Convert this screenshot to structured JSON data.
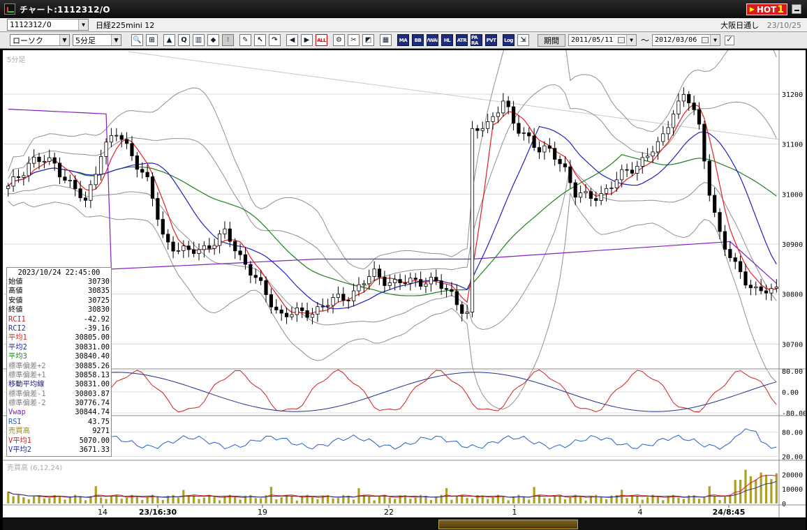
{
  "window": {
    "title": "チャート:1112312/O",
    "hot_badge": {
      "text": "HOT",
      "number": "1"
    }
  },
  "symbol_bar": {
    "symbol": "1112312/O",
    "name": "日経225mini 12",
    "session": "大阪日通し",
    "date": "23/10/25"
  },
  "toolbar": {
    "chart_type": "ローソク",
    "period": "5分足",
    "kikan_label": "期間",
    "date_from": "2011/05/11",
    "date_to": "2012/03/06",
    "date_separator": "〜",
    "buttons": [
      {
        "name": "zoom-icon",
        "glyph": "🔍"
      },
      {
        "name": "bar-width-icon",
        "glyph": "⊞"
      },
      {
        "name": "candle-add-icon",
        "glyph": "▲"
      },
      {
        "name": "search-chart-icon",
        "glyph": "Q"
      },
      {
        "name": "volume-icon",
        "glyph": "▥"
      },
      {
        "name": "split-icon",
        "glyph": "◆"
      },
      {
        "name": "warning-icon",
        "glyph": "!"
      },
      {
        "name": "pen-icon",
        "glyph": "✎"
      },
      {
        "name": "cursor-icon",
        "glyph": "↖"
      },
      {
        "name": "redo-icon",
        "glyph": "↷"
      },
      {
        "name": "candle-left-icon",
        "glyph": "◀"
      },
      {
        "name": "candle-right-icon",
        "glyph": "▶"
      },
      {
        "name": "all-icon",
        "glyph": "ALL"
      },
      {
        "name": "settings-icon",
        "glyph": "⚙"
      },
      {
        "name": "tools-icon",
        "glyph": "✂"
      },
      {
        "name": "color-icon",
        "glyph": "◩"
      },
      {
        "name": "grid-icon",
        "glyph": "▦"
      },
      {
        "name": "ma-icon",
        "glyph": "MA"
      },
      {
        "name": "bb-icon",
        "glyph": "BB"
      },
      {
        "name": "vwae-icon",
        "glyph": "VWAE"
      },
      {
        "name": "hl-icon",
        "glyph": "HL"
      },
      {
        "name": "atr-icon",
        "glyph": "ATR"
      },
      {
        "name": "para-icon",
        "glyph": "PA RA"
      },
      {
        "name": "pvt-icon",
        "glyph": "PVT"
      },
      {
        "name": "log-icon",
        "glyph": "Log"
      },
      {
        "name": "export-icon",
        "glyph": "⇲"
      }
    ]
  },
  "chart": {
    "panel_label": "5分足",
    "volume_label": "売買高 (6,12,24)",
    "price_ticks": [
      "31200",
      "31100",
      "31000",
      "30900",
      "30800",
      "30700"
    ],
    "osc_ticks": [
      "80.00",
      "0.00",
      "-80.00"
    ],
    "rsi_ticks": [
      "80.00",
      "20.00"
    ],
    "vol_ticks": [
      "20000",
      "10000",
      "0"
    ],
    "x_labels": [
      {
        "text": "14",
        "bold": false
      },
      {
        "text": "23/16:30",
        "bold": true
      },
      {
        "text": "19",
        "bold": false
      },
      {
        "text": "22",
        "bold": false
      },
      {
        "text": "1",
        "bold": false
      },
      {
        "text": "4",
        "bold": false
      },
      {
        "text": "24/8:45",
        "bold": true
      }
    ],
    "colors": {
      "candle": "#000000",
      "ma1": "#e02020",
      "ma2": "#2020c0",
      "ma3": "#208020",
      "bollinger": "#909090",
      "vwap": "#8020c0",
      "rci1": "#d02020",
      "rci2": "#203090",
      "rsi": "#2060d0",
      "volume": "#b0a020"
    }
  },
  "info": {
    "datetime": "2023/10/24 22:45:00",
    "rows": [
      {
        "label": "始値",
        "value": "30730",
        "color": "#000000"
      },
      {
        "label": "高値",
        "value": "30835",
        "color": "#000000"
      },
      {
        "label": "安値",
        "value": "30725",
        "color": "#000000"
      },
      {
        "label": "終値",
        "value": "30830",
        "color": "#000000"
      },
      {
        "label": "RCI1",
        "value": "-42.92",
        "color": "#d02020"
      },
      {
        "label": "RCI2",
        "value": "-39.16",
        "color": "#2030a0"
      },
      {
        "label": "平均1",
        "value": "30805.00",
        "color": "#e02020"
      },
      {
        "label": "平均2",
        "value": "30831.00",
        "color": "#2020c0"
      },
      {
        "label": "平均3",
        "value": "30840.40",
        "color": "#208020"
      },
      {
        "label": "標準偏差+2",
        "value": "30885.26",
        "color": "#808080"
      },
      {
        "label": "標準偏差+1",
        "value": "30858.13",
        "color": "#808080"
      },
      {
        "label": "移動平均線",
        "value": "30831.00",
        "color": "#1a1a80"
      },
      {
        "label": "標準偏差-1",
        "value": "30803.87",
        "color": "#808080"
      },
      {
        "label": "標準偏差-2",
        "value": "30776.74",
        "color": "#808080"
      },
      {
        "label": "Vwap",
        "value": "30844.74",
        "color": "#8020c0"
      },
      {
        "label": "RSI",
        "value": "43.75",
        "color": "#2060d0"
      },
      {
        "label": "売買高",
        "value": "9271",
        "color": "#9a8a10"
      },
      {
        "label": "V平均1",
        "value": "5070.00",
        "color": "#d02020"
      },
      {
        "label": "V平均2",
        "value": "3671.33",
        "color": "#2030a0"
      }
    ]
  }
}
